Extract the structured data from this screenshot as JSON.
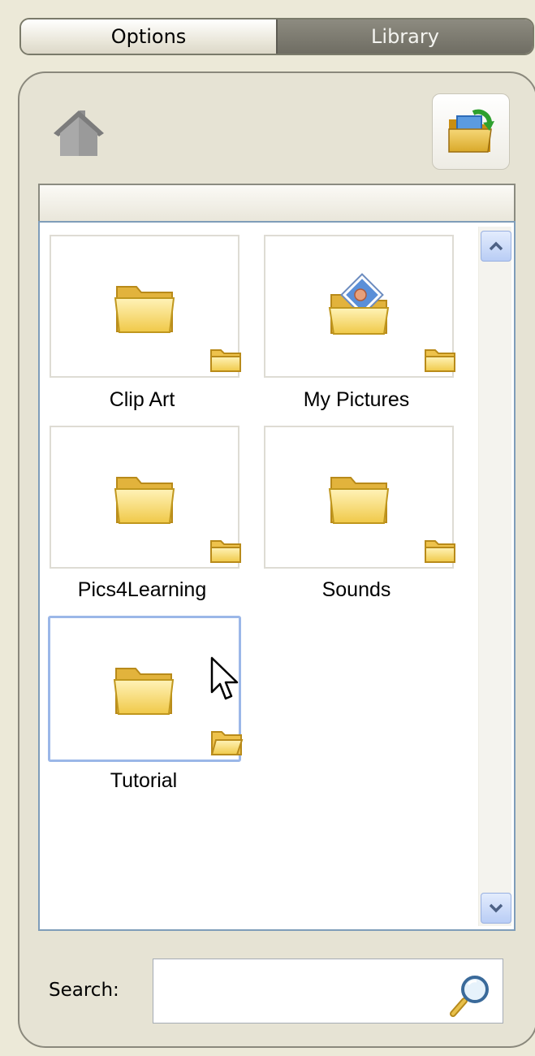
{
  "tabs": [
    {
      "label": "Options",
      "active": true
    },
    {
      "label": "Library",
      "active": false
    }
  ],
  "toolbar": {
    "home_icon": "home-icon",
    "open_folder_icon": "open-folder-icon"
  },
  "items": [
    {
      "label": "Clip Art",
      "icon": "folder-icon",
      "selected": false
    },
    {
      "label": "My Pictures",
      "icon": "my-pictures-folder-icon",
      "selected": false
    },
    {
      "label": "Pics4Learning",
      "icon": "folder-icon",
      "selected": false
    },
    {
      "label": "Sounds",
      "icon": "folder-icon",
      "selected": false
    },
    {
      "label": "Tutorial",
      "icon": "folder-icon",
      "selected": true
    }
  ],
  "search": {
    "label": "Search:",
    "value": "",
    "icon": "search-icon"
  },
  "colors": {
    "panel_bg": "#e6e3d4",
    "selection_border": "#9bb7e8",
    "folder_yellow": "#f7d66a"
  }
}
